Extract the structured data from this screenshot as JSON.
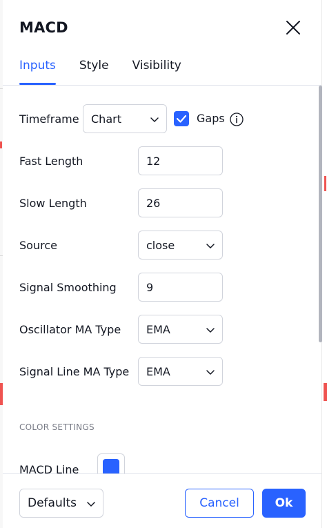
{
  "colors": {
    "accent": "#2962ff",
    "macd_line": "#2962ff",
    "border": "#d1d4dc",
    "muted_text": "#787b86"
  },
  "dialog": {
    "title": "MACD",
    "close_icon": "close-icon"
  },
  "tabs": [
    {
      "label": "Inputs",
      "active": true
    },
    {
      "label": "Style",
      "active": false
    },
    {
      "label": "Visibility",
      "active": false
    }
  ],
  "inputs": {
    "timeframe": {
      "label": "Timeframe",
      "value": "Chart"
    },
    "gaps": {
      "label": "Gaps",
      "checked": true,
      "info_icon": "info-icon"
    },
    "fast_length": {
      "label": "Fast Length",
      "value": "12"
    },
    "slow_length": {
      "label": "Slow Length",
      "value": "26"
    },
    "source": {
      "label": "Source",
      "value": "close"
    },
    "signal_smoothing": {
      "label": "Signal Smoothing",
      "value": "9"
    },
    "oscillator_ma_type": {
      "label": "Oscillator MA Type",
      "value": "EMA"
    },
    "signal_line_ma_type": {
      "label": "Signal Line MA Type",
      "value": "EMA"
    }
  },
  "color_settings": {
    "section_title": "COLOR SETTINGS",
    "macd_line": {
      "label": "MACD Line"
    }
  },
  "footer": {
    "defaults_label": "Defaults",
    "cancel_label": "Cancel",
    "ok_label": "Ok"
  }
}
